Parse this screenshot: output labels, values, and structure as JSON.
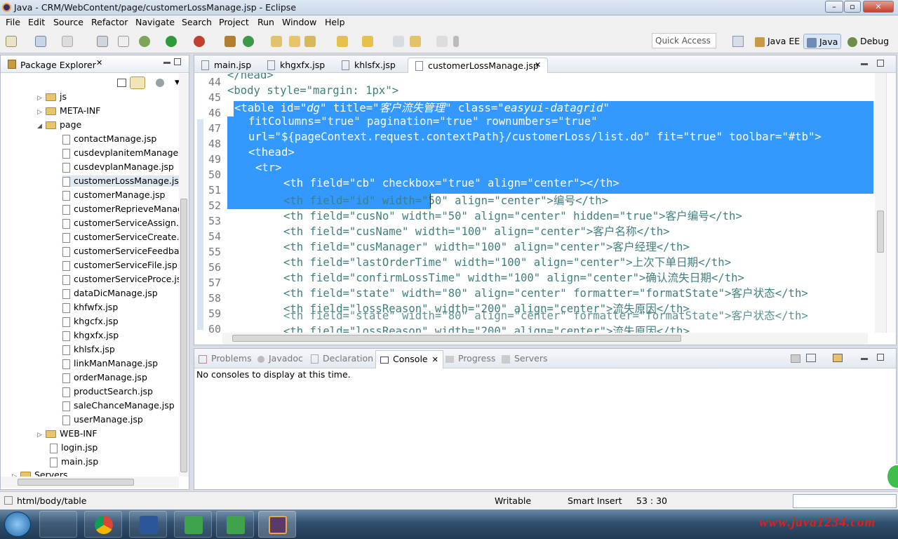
{
  "window": {
    "title": "Java - CRM/WebContent/page/customerLossManage.jsp - Eclipse"
  },
  "menu": [
    "File",
    "Edit",
    "Source",
    "Refactor",
    "Navigate",
    "Search",
    "Project",
    "Run",
    "Window",
    "Help"
  ],
  "toolbar": {
    "quick_access_placeholder": "Quick Access",
    "perspectives": [
      "Java EE",
      "Java",
      "Debug"
    ]
  },
  "package_explorer": {
    "title": "Package Explorer",
    "folders": {
      "js": "js",
      "meta_inf": "META-INF",
      "page": "page",
      "web_inf": "WEB-INF",
      "servers": "Servers"
    },
    "page_files": [
      "contactManage.jsp",
      "cusdevplanitemManage.js",
      "cusdevplanManage.jsp",
      "customerLossManage.jsp",
      "customerManage.jsp",
      "customerReprieveManag",
      "customerServiceAssign.js",
      "customerServiceCreate.js",
      "customerServiceFeedbacl",
      "customerServiceFile.jsp",
      "customerServiceProce.jsp",
      "dataDicManage.jsp",
      "khfwfx.jsp",
      "khgcfx.jsp",
      "khgxfx.jsp",
      "khlsfx.jsp",
      "linkManManage.jsp",
      "orderManage.jsp",
      "productSearch.jsp",
      "saleChanceManage.jsp",
      "userManage.jsp"
    ],
    "root_files": [
      "login.jsp",
      "main.jsp"
    ]
  },
  "editor": {
    "tabs": [
      "main.jsp",
      "khgxfx.jsp",
      "khlsfx.jsp",
      "customerLossManage.jsp"
    ],
    "line_numbers": [
      "44",
      "45",
      "46",
      "47",
      "48",
      "49",
      "50",
      "51",
      "52",
      "53",
      "54",
      "55",
      "56",
      "57",
      "58",
      "59",
      "60"
    ],
    "lines": {
      "l43": "</head>",
      "l44": "<body style=\"margin: 1px\">",
      "l46a": "<table id=",
      "l46b": "\"dg\"",
      "l46c": " title=",
      "l46d": "\"客户流失管理\"",
      "l46e": " class=",
      "l46f": "\"easyui-datagrid\"",
      "l47": "fitColumns=\"true\" pagination=\"true\" rownumbers=\"true\"",
      "l48": "url=\"${pageContext.request.contextPath}/customerLoss/list.do\" fit=\"true\" toolbar=\"#tb\">",
      "l49": "<thead>",
      "l50": "<tr>",
      "l51": "<th field=\"cb\" checkbox=\"true\" align=\"center\"></th>",
      "l52": "<th field=\"id\" width=\"50\" align=\"center\">编号</th>",
      "l53": "<th field=\"cusNo\" width=\"50\" align=\"center\" hidden=\"true\">客户编号</th>",
      "l54": "<th field=\"cusName\" width=\"100\" align=\"center\">客户名称</th>",
      "l55": "<th field=\"cusManager\" width=\"100\" align=\"center\">客户经理</th>",
      "l56": "<th field=\"lastOrderTime\" width=\"100\" align=\"center\">上次下单日期</th>",
      "l57": "<th field=\"confirmLossTime\" width=\"100\" align=\"center\">确认流失日期</th>",
      "l58": "<th field=\"state\" width=\"80\" align=\"center\" formatter=\"formatState\">客户状态</th>",
      "l59": "<th field=\"lossReason\" width=\"200\" align=\"center\">流失原因</th>"
    }
  },
  "bottom_panel": {
    "tabs": [
      "Problems",
      "Javadoc",
      "Declaration",
      "Console",
      "Progress",
      "Servers"
    ],
    "message": "No consoles to display at this time."
  },
  "status": {
    "path": "html/body/table",
    "mode": "Writable",
    "insert": "Smart Insert",
    "position": "53 : 30"
  },
  "watermark": "www.java1234.com"
}
